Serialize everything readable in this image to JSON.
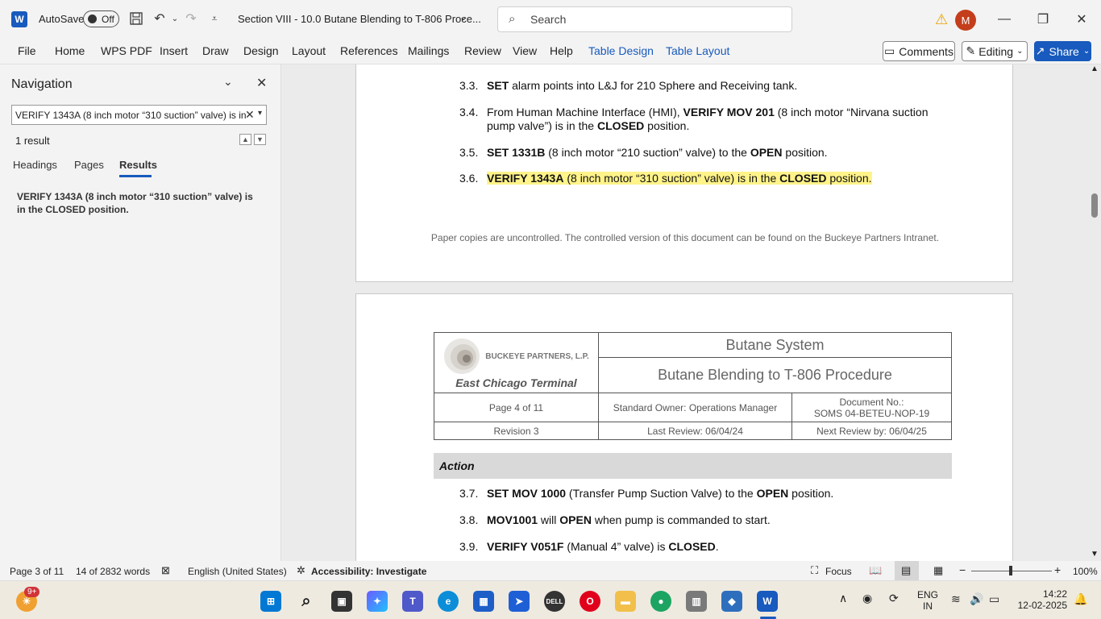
{
  "titlebar": {
    "autosave_label": "AutoSave",
    "toggle_state": "Off",
    "doc_title": "Section VIII - 10.0 Butane Blending to T-806 Proce...",
    "search_placeholder": "Search",
    "avatar_initial": "M"
  },
  "menu": {
    "items": [
      "File",
      "Home",
      "WPS PDF",
      "Insert",
      "Draw",
      "Design",
      "Layout",
      "References",
      "Mailings",
      "Review",
      "View",
      "Help",
      "Table Design",
      "Table Layout"
    ],
    "comments": "Comments",
    "editing": "Editing",
    "share": "Share"
  },
  "nav": {
    "title": "Navigation",
    "search_value": "VERIFY 1343A (8 inch motor “310 suction” valve) is in",
    "result_count": "1 result",
    "tabs": [
      "Headings",
      "Pages",
      "Results"
    ],
    "result_text": "VERIFY 1343A (8 inch motor “310 suction” valve) is in the CLOSED position."
  },
  "page1": {
    "s33_num": "3.3.",
    "s33_bold": "SET",
    "s33_rest": " alarm points into L&J for 210 Sphere and Receiving tank.",
    "s34_num": "3.4.",
    "s34_a": "From Human Machine Interface (HMI), ",
    "s34_b": "VERIFY MOV 201",
    "s34_c": " (8 inch motor “Nirvana suction",
    "s34_d": "pump valve”) is in the ",
    "s34_e": "CLOSED",
    "s34_f": " position.",
    "s35_num": "3.5.",
    "s35_a": "SET 1331B",
    "s35_b": " (8 inch motor “210 suction” valve) to the ",
    "s35_c": "OPEN",
    "s35_d": " position.",
    "s36_num": "3.6.",
    "s36_a": "VERIFY 1343A",
    "s36_b": " (8 inch motor “310 suction” valve) is in the ",
    "s36_c": "CLOSED",
    "s36_d": " position.",
    "footer": "Paper copies are uncontrolled. The controlled version of this document can be found on the Buckeye Partners Intranet."
  },
  "page2": {
    "logo_text": "BUCKEYE PARTNERS, L.P.",
    "terminal": "East Chicago Terminal",
    "system": "Butane System",
    "procedure": "Butane Blending to T-806 Procedure",
    "page_of": "Page 4 of 11",
    "owner": "Standard Owner: Operations Manager",
    "doc_no_label": "Document No.:",
    "doc_no": "SOMS 04-BETEU-NOP-19",
    "revision": "Revision 3",
    "last_review": "Last Review: 06/04/24",
    "next_review": "Next Review by: 06/04/25",
    "action": "Action",
    "s37_num": "3.7.",
    "s37_a": "SET MOV 1000",
    "s37_b": " (Transfer Pump Suction Valve) to the ",
    "s37_c": "OPEN",
    "s37_d": " position.",
    "s38_num": "3.8.",
    "s38_a": "MOV1001",
    "s38_b": " will ",
    "s38_c": "OPEN",
    "s38_d": " when pump is commanded to start.",
    "s39_num": "3.9.",
    "s39_a": "VERIFY V051F",
    "s39_b": " (Manual 4” valve) is ",
    "s39_c": "CLOSED",
    "s39_d": "."
  },
  "status": {
    "page": "Page 3 of 11",
    "words": "14 of 2832 words",
    "language": "English (United States)",
    "accessibility": "Accessibility: Investigate",
    "focus": "Focus",
    "zoom": "100%"
  },
  "taskbar": {
    "badge": "9+",
    "lang1": "ENG",
    "lang2": "IN",
    "time": "14:22",
    "date": "12-02-2025"
  },
  "colors": {
    "accent": "#185abd",
    "highlight": "#fff38a"
  }
}
